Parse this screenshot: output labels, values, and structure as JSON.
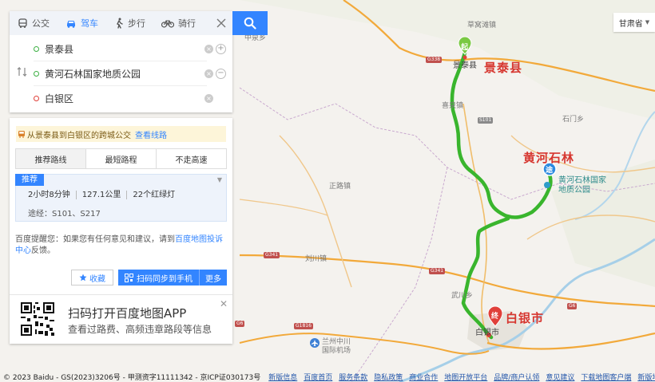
{
  "modes": [
    {
      "label": "公交",
      "icon": "bus-icon"
    },
    {
      "label": "驾车",
      "icon": "car-icon"
    },
    {
      "label": "步行",
      "icon": "walk-icon"
    },
    {
      "label": "骑行",
      "icon": "bike-icon"
    }
  ],
  "active_mode": "驾车",
  "waypoints": {
    "start": "景泰县",
    "via": "黄河石林国家地质公园",
    "end": "白银区"
  },
  "notice": {
    "text": "从景泰县到白银区的跨城公交",
    "link": "查看线路"
  },
  "route_tabs": [
    "推荐路线",
    "最短路程",
    "不走高速"
  ],
  "plan": {
    "badge": "推荐",
    "duration": "2小时8分钟",
    "distance": "127.1公里",
    "lights": "22个红绿灯",
    "via": "途经：S101、S217"
  },
  "tip": {
    "before": "百度提醒您：如果您有任何意见和建议，请到",
    "link": "百度地图投诉中心",
    "after": "反馈。"
  },
  "buttons": {
    "favorite": "收藏",
    "scan": "扫码同步到手机",
    "more": "更多"
  },
  "promo": {
    "title": "扫码打开百度地图APP",
    "subtitle": "查看过路费、高频违章路段等信息"
  },
  "province": "甘肃省",
  "map_labels": {
    "jingtai_big": "景泰县",
    "jingtai_small": "景泰县",
    "shilin_big": "黄河石林",
    "shilin_poi_1": "黄河石林国家",
    "shilin_poi_2": "地质公园",
    "baiyin_big": "白银市",
    "baiyin_small": "白银市",
    "start_marker": "起",
    "via_marker": "途",
    "end_marker": "终",
    "caotan": "草窝滩镇",
    "xibao": "喜泉镇",
    "shimen": "石门乡",
    "zhengluzhen": "正路镇",
    "liuchuan": "刘川镇",
    "wuchuan": "武川乡",
    "airport": "兰州中川\n国际机场",
    "top_town": "中泉乡"
  },
  "road_shields": [
    "G338",
    "G341",
    "G341",
    "G6",
    "G1816",
    "G6",
    "S101"
  ],
  "footer": {
    "copyright": "© 2023 Baidu - GS(2023)3206号 - 甲测资字11111342 - 京ICP证030173号",
    "links": [
      "新版信息",
      "百度首页",
      "服务条款",
      "隐私政策",
      "商业合作",
      "地图开放平台",
      "品牌/商户认领",
      "意见建议",
      "下载地图客户端",
      "新版地图"
    ]
  },
  "colors": {
    "accent": "#3385ff",
    "route": "#39b52d",
    "city_label": "#d6362f"
  }
}
